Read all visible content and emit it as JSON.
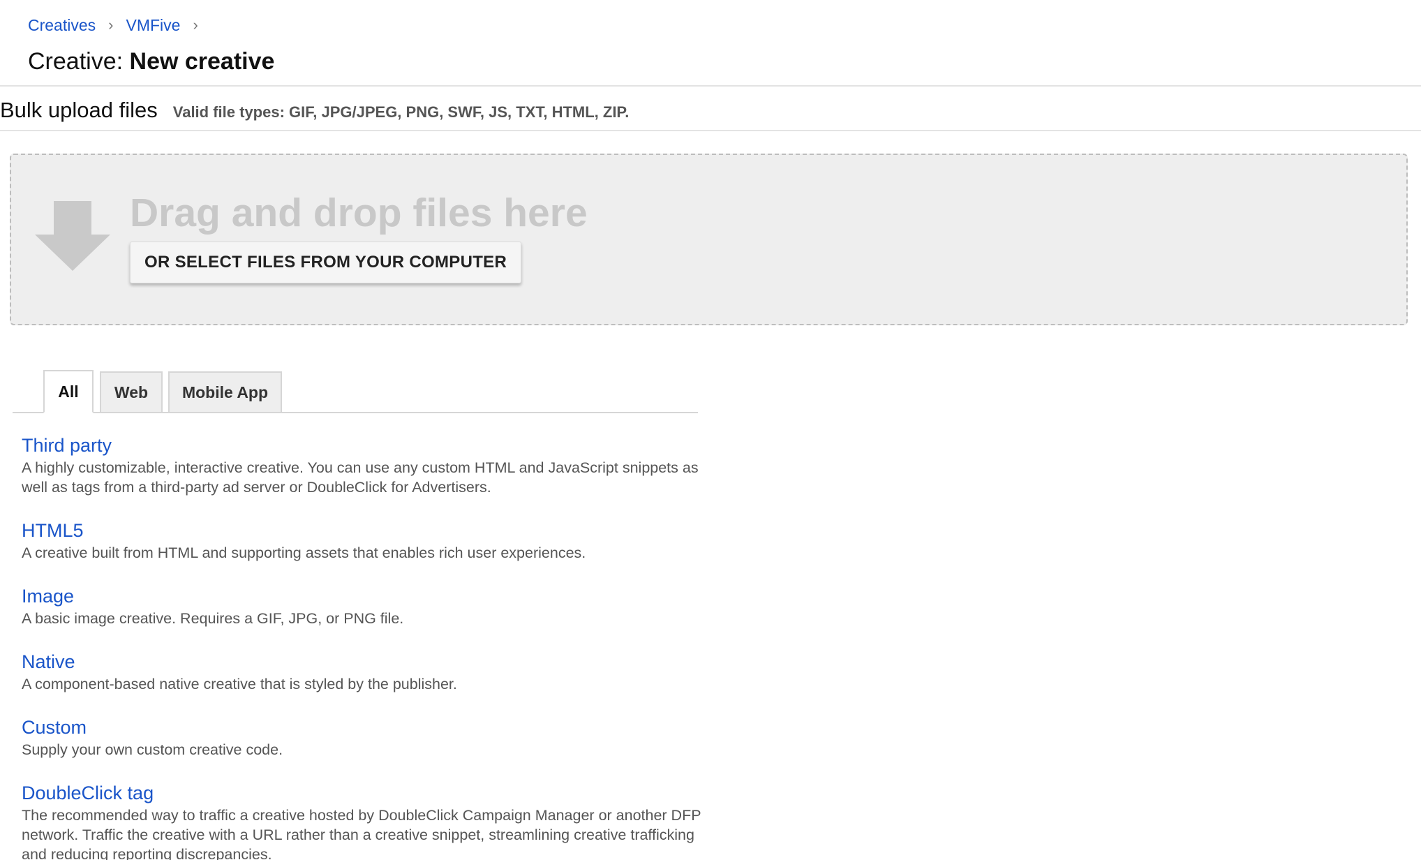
{
  "breadcrumb": {
    "items": [
      "Creatives",
      "VMFive"
    ],
    "separator": "›"
  },
  "title": {
    "prefix": "Creative:",
    "name": "New creative"
  },
  "bulk_upload": {
    "title": "Bulk upload files",
    "valid_types": "Valid file types: GIF, JPG/JPEG, PNG, SWF, JS, TXT, HTML, ZIP.",
    "drop_text": "Drag and drop files here",
    "select_button": "OR SELECT FILES FROM YOUR COMPUTER",
    "icon": "download-arrow-icon"
  },
  "tabs": [
    {
      "label": "All",
      "active": true
    },
    {
      "label": "Web",
      "active": false
    },
    {
      "label": "Mobile App",
      "active": false
    }
  ],
  "creative_types": [
    {
      "name": "Third party",
      "description": "A highly customizable, interactive creative. You can use any custom HTML and JavaScript snippets as well as tags from a third-party ad server or DoubleClick for Advertisers."
    },
    {
      "name": "HTML5",
      "description": "A creative built from HTML and supporting assets that enables rich user experiences."
    },
    {
      "name": "Image",
      "description": "A basic image creative. Requires a GIF, JPG, or PNG file."
    },
    {
      "name": "Native",
      "description": "A component-based native creative that is styled by the publisher."
    },
    {
      "name": "Custom",
      "description": "Supply your own custom creative code."
    },
    {
      "name": "DoubleClick tag",
      "description": "The recommended way to traffic a creative hosted by DoubleClick Campaign Manager or another DFP network. Traffic the creative with a URL rather than a creative snippet, streamlining creative trafficking and reducing reporting discrepancies."
    }
  ],
  "colors": {
    "link": "#1a55c9",
    "dropzone_bg": "#eeeeee",
    "drop_text": "#c8c8c8"
  }
}
